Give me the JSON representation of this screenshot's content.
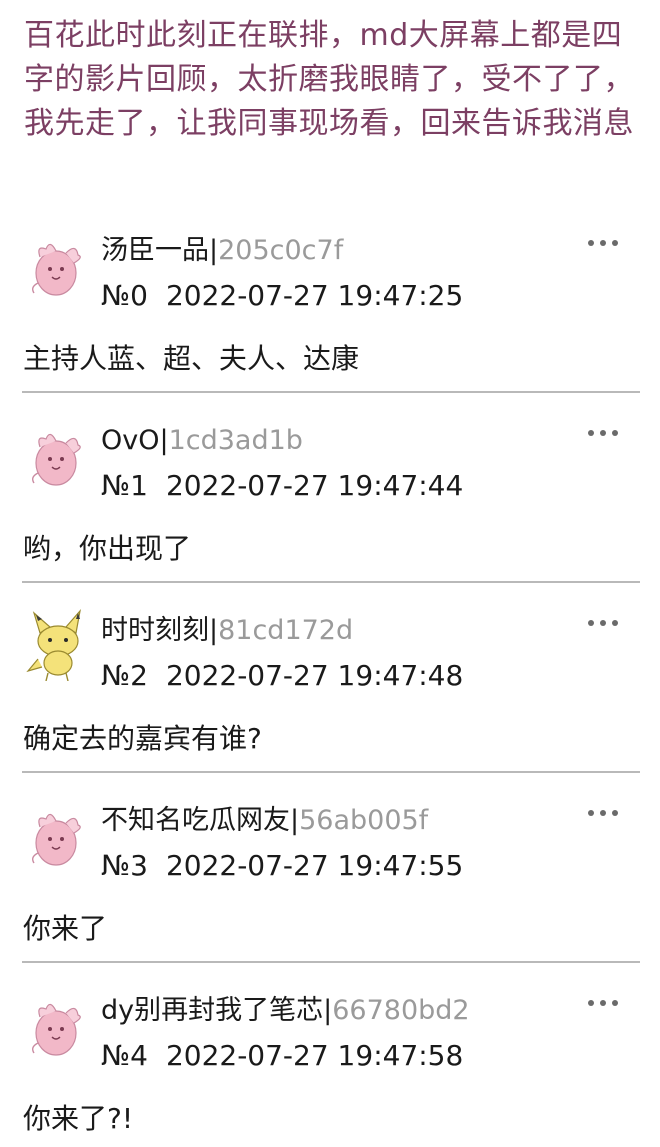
{
  "post": {
    "text": "百花此时此刻正在联排，md大屏幕上都是四字的影片回顾，太折磨我眼睛了，受不了了，我先走了，让我同事现场看，回来告诉我消息"
  },
  "replies": [
    {
      "username": "汤臣一品",
      "separator": "|",
      "uid": "205c0c7f",
      "floor": "№0",
      "time": "2022-07-27 19:47:25",
      "content": "主持人蓝、超、夫人、达康",
      "avatar_icon": "pink-creature-avatar-icon"
    },
    {
      "username": "OvO",
      "separator": "|",
      "uid": "1cd3ad1b",
      "floor": "№1",
      "time": "2022-07-27 19:47:44",
      "content": "哟，你出现了",
      "avatar_icon": "pink-creature-avatar-icon"
    },
    {
      "username": "时时刻刻",
      "separator": "|",
      "uid": "81cd172d",
      "floor": "№2",
      "time": "2022-07-27 19:47:48",
      "content": "确定去的嘉宾有谁?",
      "avatar_icon": "yellow-creature-avatar-icon"
    },
    {
      "username": "不知名吃瓜网友",
      "separator": "|",
      "uid": "56ab005f",
      "floor": "№3",
      "time": "2022-07-27 19:47:55",
      "content": "你来了",
      "avatar_icon": "pink-creature-avatar-icon"
    },
    {
      "username": "dy别再封我了笔芯",
      "separator": "|",
      "uid": "66780bd2",
      "floor": "№4",
      "time": "2022-07-27 19:47:58",
      "content": "你来了?!",
      "avatar_icon": "pink-creature-avatar-icon"
    }
  ],
  "colors": {
    "post_text": "#7c3f63",
    "uid_text": "#9a9a9a",
    "divider": "#b9b9b9",
    "pink_avatar": "#f2b8c8",
    "yellow_avatar": "#f4e27a"
  }
}
